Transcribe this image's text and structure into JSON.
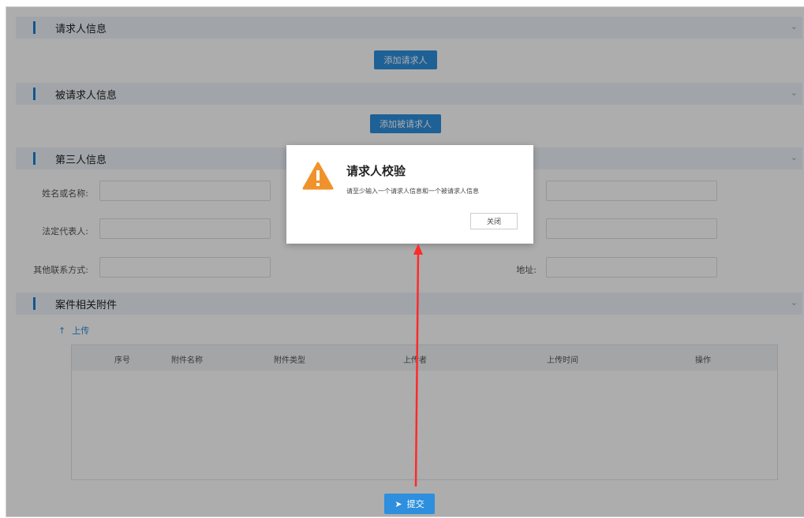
{
  "sections": {
    "requester": {
      "title": "请求人信息",
      "add_button": "添加请求人"
    },
    "respondent": {
      "title": "被请求人信息",
      "add_button": "添加被请求人"
    },
    "third_party": {
      "title": "第三人信息",
      "name_label": "姓名或名称:",
      "legal_rep_label": "法定代表人:",
      "contact_label": "其他联系方式:",
      "address_label": "地址:"
    },
    "attachments": {
      "title": "案件相关附件",
      "upload_label": "上传",
      "columns": [
        "序号",
        "附件名称",
        "附件类型",
        "上传者",
        "上传时间",
        "操作"
      ]
    }
  },
  "dialog": {
    "title": "请求人校验",
    "message": "请至少输入一个请求人信息和一个被请求人信息",
    "close_label": "关闭"
  },
  "submit_label": "提交",
  "colors": {
    "accent": "#2d8fdd",
    "header_bg": "#eef4f9",
    "warning": "#f0922b",
    "annotation_arrow": "#ff2a2a"
  },
  "icons": {
    "warning": "warning-icon",
    "upload": "upload-arrow-icon",
    "submit": "send-icon",
    "collapse": "chevron-down-icon"
  }
}
